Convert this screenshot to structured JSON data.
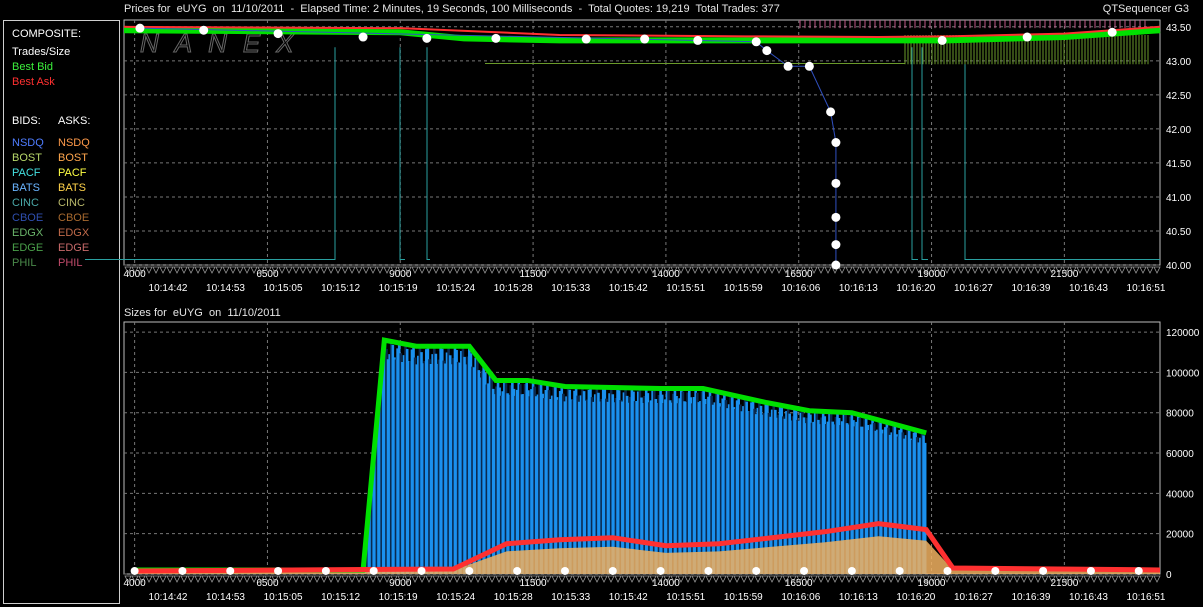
{
  "header": {
    "title": "Prices for  eUYG  on  11/10/2011  -  Elapsed Time: 2 Minutes, 19 Seconds, 100 Milliseconds  -  Total Quotes: 19,219  Total Trades: 377",
    "app": "QTSequencer G3",
    "sizes_title": "Sizes for  eUYG  on  11/10/2011",
    "watermark": "NANEX"
  },
  "legend": {
    "composite_label": "COMPOSITE:",
    "trades_label": "Trades/Size",
    "best_bid_label": "Best Bid",
    "best_ask_label": "Best Ask",
    "bids_label": "BIDS:",
    "asks_label": "ASKS:",
    "exchanges": [
      {
        "name": "NSDQ",
        "bid_color": "#4f7dff",
        "ask_color": "#ff9a4a"
      },
      {
        "name": "BOST",
        "bid_color": "#b8d86a",
        "ask_color": "#ffa64d"
      },
      {
        "name": "PACF",
        "bid_color": "#44e0e0",
        "ask_color": "#ffff44"
      },
      {
        "name": "BATS",
        "bid_color": "#6ab4ff",
        "ask_color": "#ffd24a"
      },
      {
        "name": "CINC",
        "bid_color": "#4aa8a8",
        "ask_color": "#b8b86a"
      },
      {
        "name": "CBOE",
        "bid_color": "#2f4fb0",
        "ask_color": "#a86a2f"
      },
      {
        "name": "EDGX",
        "bid_color": "#6ab46a",
        "ask_color": "#c06a4a"
      },
      {
        "name": "EDGE",
        "bid_color": "#4aa04a",
        "ask_color": "#c86a6a"
      },
      {
        "name": "PHIL",
        "bid_color": "#4a8a4a",
        "ask_color": "#c04a6a"
      }
    ]
  },
  "chart_data": [
    {
      "type": "line",
      "title": "Prices for  eUYG  on  11/10/2011",
      "x_ticks": [
        "4000",
        "6500",
        "9000",
        "11500",
        "14000",
        "16500",
        "19000",
        "21500"
      ],
      "time_ticks": [
        "10:14:42",
        "10:14:53",
        "10:15:05",
        "10:15:12",
        "10:15:19",
        "10:15:24",
        "10:15:28",
        "10:15:33",
        "10:15:42",
        "10:15:51",
        "10:15:59",
        "10:16:06",
        "10:16:13",
        "10:16:20",
        "10:16:27",
        "10:16:39",
        "10:16:43",
        "10:16:51"
      ],
      "y_ticks": [
        "43.50",
        "43.00",
        "42.50",
        "42.00",
        "41.50",
        "41.00",
        "40.50",
        "40.00"
      ],
      "ylim": [
        40.0,
        43.6
      ],
      "xlim": [
        3800,
        23300
      ],
      "grid": true,
      "series": [
        {
          "name": "Best Bid",
          "color": "#00e000",
          "x": [
            3800,
            9000,
            10200,
            12000,
            15500,
            18000,
            19300,
            21500,
            23300
          ],
          "values": [
            43.45,
            43.42,
            43.33,
            43.3,
            43.3,
            43.3,
            43.3,
            43.35,
            43.45
          ]
        },
        {
          "name": "Best Ask",
          "color": "#ff3030",
          "x": [
            3800,
            9000,
            12000,
            15500,
            18000,
            19300,
            21500,
            23300
          ],
          "values": [
            43.5,
            43.48,
            43.38,
            43.36,
            43.35,
            43.36,
            43.4,
            43.5
          ]
        },
        {
          "name": "Trades/Size",
          "color": "#ffffff",
          "x": [
            4100,
            5300,
            6700,
            8300,
            9500,
            10800,
            12500,
            13600,
            14600,
            15700,
            15900,
            16300,
            16700,
            17100,
            17200,
            17200,
            17200,
            17200,
            17200,
            19200,
            20800,
            22400
          ],
          "values": [
            43.48,
            43.45,
            43.4,
            43.35,
            43.33,
            43.33,
            43.32,
            43.32,
            43.3,
            43.28,
            43.15,
            42.92,
            42.92,
            42.25,
            41.8,
            41.2,
            40.7,
            40.3,
            40.0,
            43.3,
            43.35,
            43.42
          ]
        }
      ]
    },
    {
      "type": "bar",
      "title": "Sizes for  eUYG  on  11/10/2011",
      "x_ticks": [
        "4000",
        "6500",
        "9000",
        "11500",
        "14000",
        "16500",
        "19000",
        "21500"
      ],
      "time_ticks": [
        "10:14:42",
        "10:14:53",
        "10:15:05",
        "10:15:12",
        "10:15:19",
        "10:15:24",
        "10:15:28",
        "10:15:33",
        "10:15:42",
        "10:15:51",
        "10:15:59",
        "10:16:06",
        "10:16:13",
        "10:16:20",
        "10:16:27",
        "10:16:39",
        "10:16:43",
        "10:16:51"
      ],
      "y_ticks": [
        "120000",
        "100000",
        "80000",
        "60000",
        "40000",
        "20000",
        "0"
      ],
      "ylim": [
        0,
        125000
      ],
      "xlim": [
        3800,
        23300
      ],
      "grid": true,
      "series": [
        {
          "name": "Best Bid",
          "color": "#00e000",
          "x": [
            4000,
            8300,
            8700,
            9300,
            10300,
            10800,
            11400,
            12100,
            13900,
            14700,
            15900,
            16700,
            17500,
            18200,
            18900
          ],
          "values": [
            2000,
            2000,
            116000,
            113000,
            113000,
            96000,
            96000,
            93000,
            92000,
            92000,
            85000,
            81000,
            80000,
            75000,
            70000
          ]
        },
        {
          "name": "Best Ask",
          "color": "#ff3030",
          "x": [
            4000,
            10000,
            11000,
            12000,
            13000,
            14000,
            15000,
            16000,
            17000,
            18000,
            18900,
            19400,
            23300
          ],
          "values": [
            1500,
            2500,
            15000,
            17000,
            18000,
            14000,
            15000,
            18000,
            21000,
            25000,
            22000,
            3000,
            2000
          ]
        }
      ]
    }
  ]
}
